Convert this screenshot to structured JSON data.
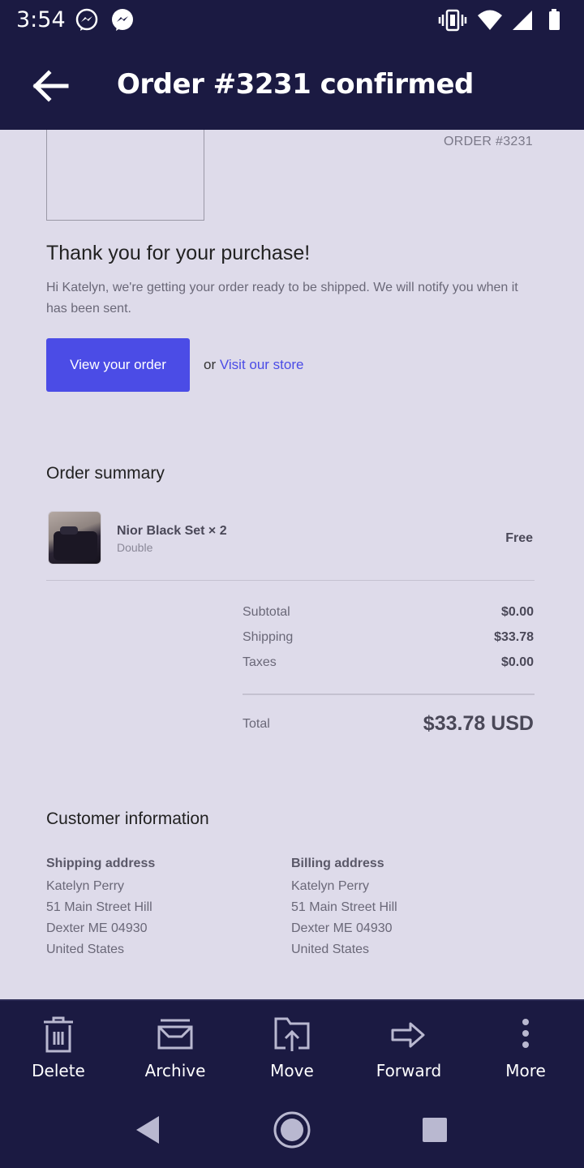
{
  "status_bar": {
    "time": "3:54",
    "icons": [
      "messenger-icon",
      "messenger-icon",
      "vibrate-icon",
      "wifi-icon",
      "signal-icon",
      "battery-icon"
    ]
  },
  "app_bar": {
    "title": "Order #3231 confirmed",
    "back_icon": "arrow-left-icon"
  },
  "email": {
    "order_label": "ORDER #3231",
    "thanks_heading": "Thank you for your purchase!",
    "message": "Hi Katelyn, we're getting your order ready to be shipped. We will notify you when it has been sent.",
    "view_order_button": "View your order",
    "or_text": "or",
    "visit_store_link": "Visit our store",
    "order_summary_title": "Order summary",
    "item": {
      "name": "Nior Black Set × 2",
      "variant": "Double",
      "price": "Free"
    },
    "summary": {
      "subtotal_label": "Subtotal",
      "subtotal_value": "$0.00",
      "shipping_label": "Shipping",
      "shipping_value": "$33.78",
      "taxes_label": "Taxes",
      "taxes_value": "$0.00",
      "total_label": "Total",
      "total_value": "$33.78 USD"
    },
    "customer_info_title": "Customer information",
    "shipping_address": {
      "heading": "Shipping address",
      "lines": [
        "Katelyn Perry",
        "51 Main Street Hill",
        "Dexter ME 04930",
        "United States"
      ]
    },
    "billing_address": {
      "heading": "Billing address",
      "lines": [
        "Katelyn Perry",
        "51 Main Street Hill",
        "Dexter ME 04930",
        "United States"
      ]
    }
  },
  "actions": {
    "delete": "Delete",
    "archive": "Archive",
    "move": "Move",
    "forward": "Forward",
    "more": "More"
  },
  "colors": {
    "header_bg": "#1b1a42",
    "content_bg": "#dedbea",
    "accent": "#4b4ce6"
  }
}
